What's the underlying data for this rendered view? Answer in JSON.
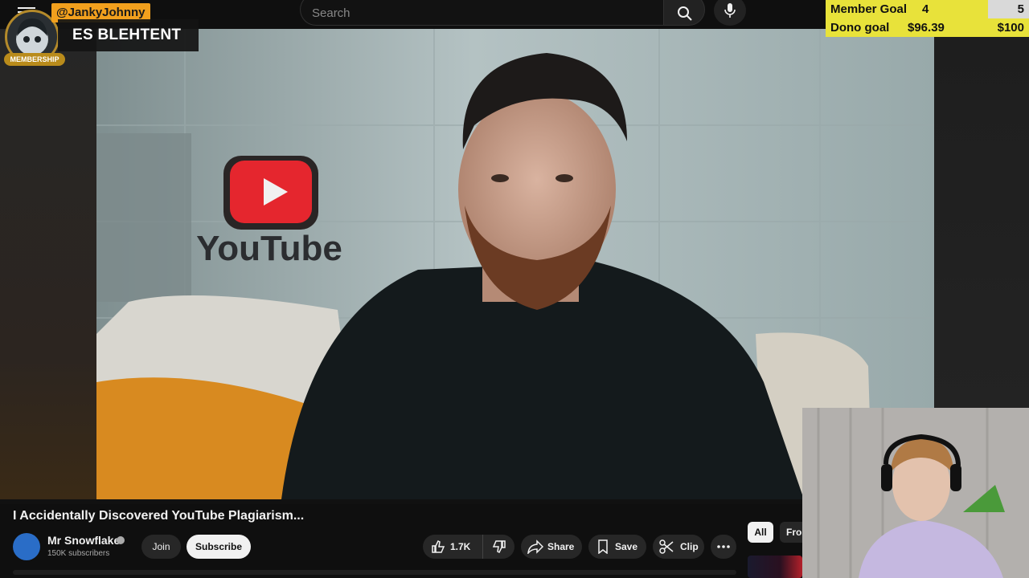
{
  "stream_overlay": {
    "member_tag": "@JankyJohnny",
    "name_plate": "ES BLEHTENT",
    "membership_badge": "MEMBERSHIP",
    "goals": {
      "member_label": "Member Goal",
      "member_current": "4",
      "member_target": "5",
      "dono_label": "Dono goal",
      "dono_current": "$96.39",
      "dono_target": "$100"
    }
  },
  "header": {
    "search_placeholder": "Search",
    "icons": [
      "menu-icon",
      "search-icon",
      "microphone-icon"
    ]
  },
  "video": {
    "title": "I Accidentally Discovered YouTube Plagiarism...",
    "channel_name": "Mr Snowflake",
    "subscribers": "150K subscribers",
    "join_label": "Join",
    "subscribe_label": "Subscribe",
    "like_count": "1.7K",
    "share_label": "Share",
    "save_label": "Save",
    "clip_label": "Clip",
    "logo_text": "YouTube"
  },
  "sidebar": {
    "chips": [
      "All",
      "From"
    ]
  },
  "colors": {
    "background": "#0f0f0f",
    "goal_yellow": "#e8e23a",
    "member_orange": "#f2a01d",
    "youtube_red": "#e5262e"
  }
}
